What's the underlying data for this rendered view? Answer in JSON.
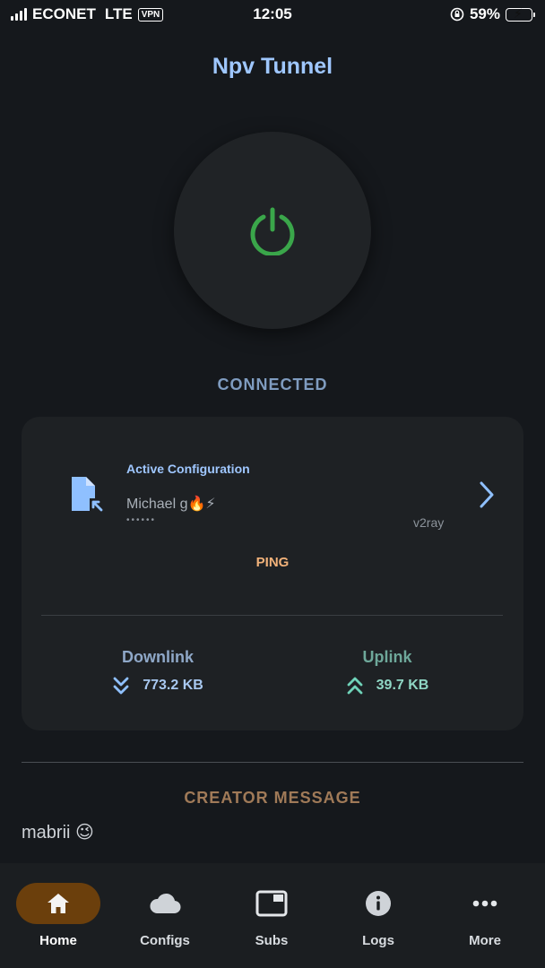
{
  "status_bar": {
    "carrier": "ECONET",
    "network": "LTE",
    "vpn": "VPN",
    "time": "12:05",
    "battery": "59%",
    "battery_level": 0.59
  },
  "app": {
    "title": "Npv Tunnel"
  },
  "connection": {
    "status": "CONNECTED",
    "power_color": "#3aa64a"
  },
  "config": {
    "label": "Active Configuration",
    "name": "Michael g🔥⚡",
    "masked": "••••••",
    "protocol": "v2ray",
    "ping_label": "PING"
  },
  "stats": {
    "downlink_label": "Downlink",
    "downlink_value": "773.2 KB",
    "uplink_label": "Uplink",
    "uplink_value": "39.7 KB"
  },
  "creator": {
    "title": "CREATOR MESSAGE",
    "message": "mabrii 😉"
  },
  "nav": [
    {
      "label": "Home",
      "icon": "home-icon",
      "active": true
    },
    {
      "label": "Configs",
      "icon": "cloud-icon",
      "active": false
    },
    {
      "label": "Subs",
      "icon": "window-icon",
      "active": false
    },
    {
      "label": "Logs",
      "icon": "info-icon",
      "active": false
    },
    {
      "label": "More",
      "icon": "more-icon",
      "active": false
    }
  ],
  "colors": {
    "accent": "#9fc7ff",
    "background": "#15181c",
    "active_nav": "#6b3f0c"
  }
}
